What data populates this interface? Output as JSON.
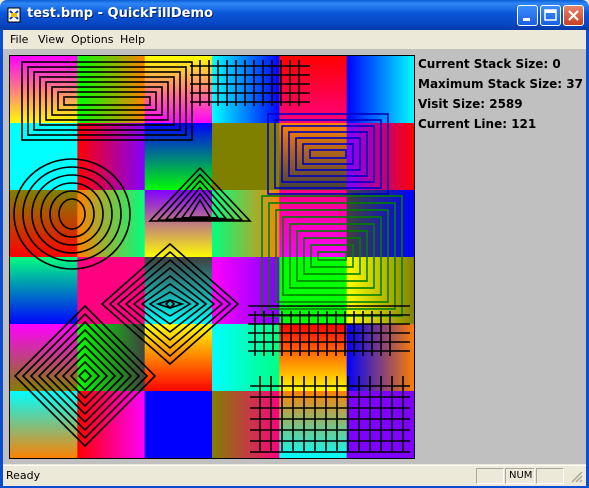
{
  "window": {
    "title": "test.bmp - QuickFillDemo"
  },
  "menu": [
    "File",
    "View",
    "Options",
    "Help"
  ],
  "info": {
    "stack_size": "Current Stack Size: 0",
    "max_stack": "Maximum Stack Size: 37",
    "visit_size": "Visit Size: 2589",
    "current_line": "Current Line: 121"
  },
  "status": {
    "text": "Ready",
    "num": "NUM"
  },
  "colors": {
    "titlebar": "#0a55d8",
    "client": "#c0c0c0",
    "chrome": "#ece9d8",
    "fill_line": "#008000"
  },
  "icons": [
    "app-icon",
    "minimize-icon",
    "maximize-icon",
    "close-icon"
  ]
}
